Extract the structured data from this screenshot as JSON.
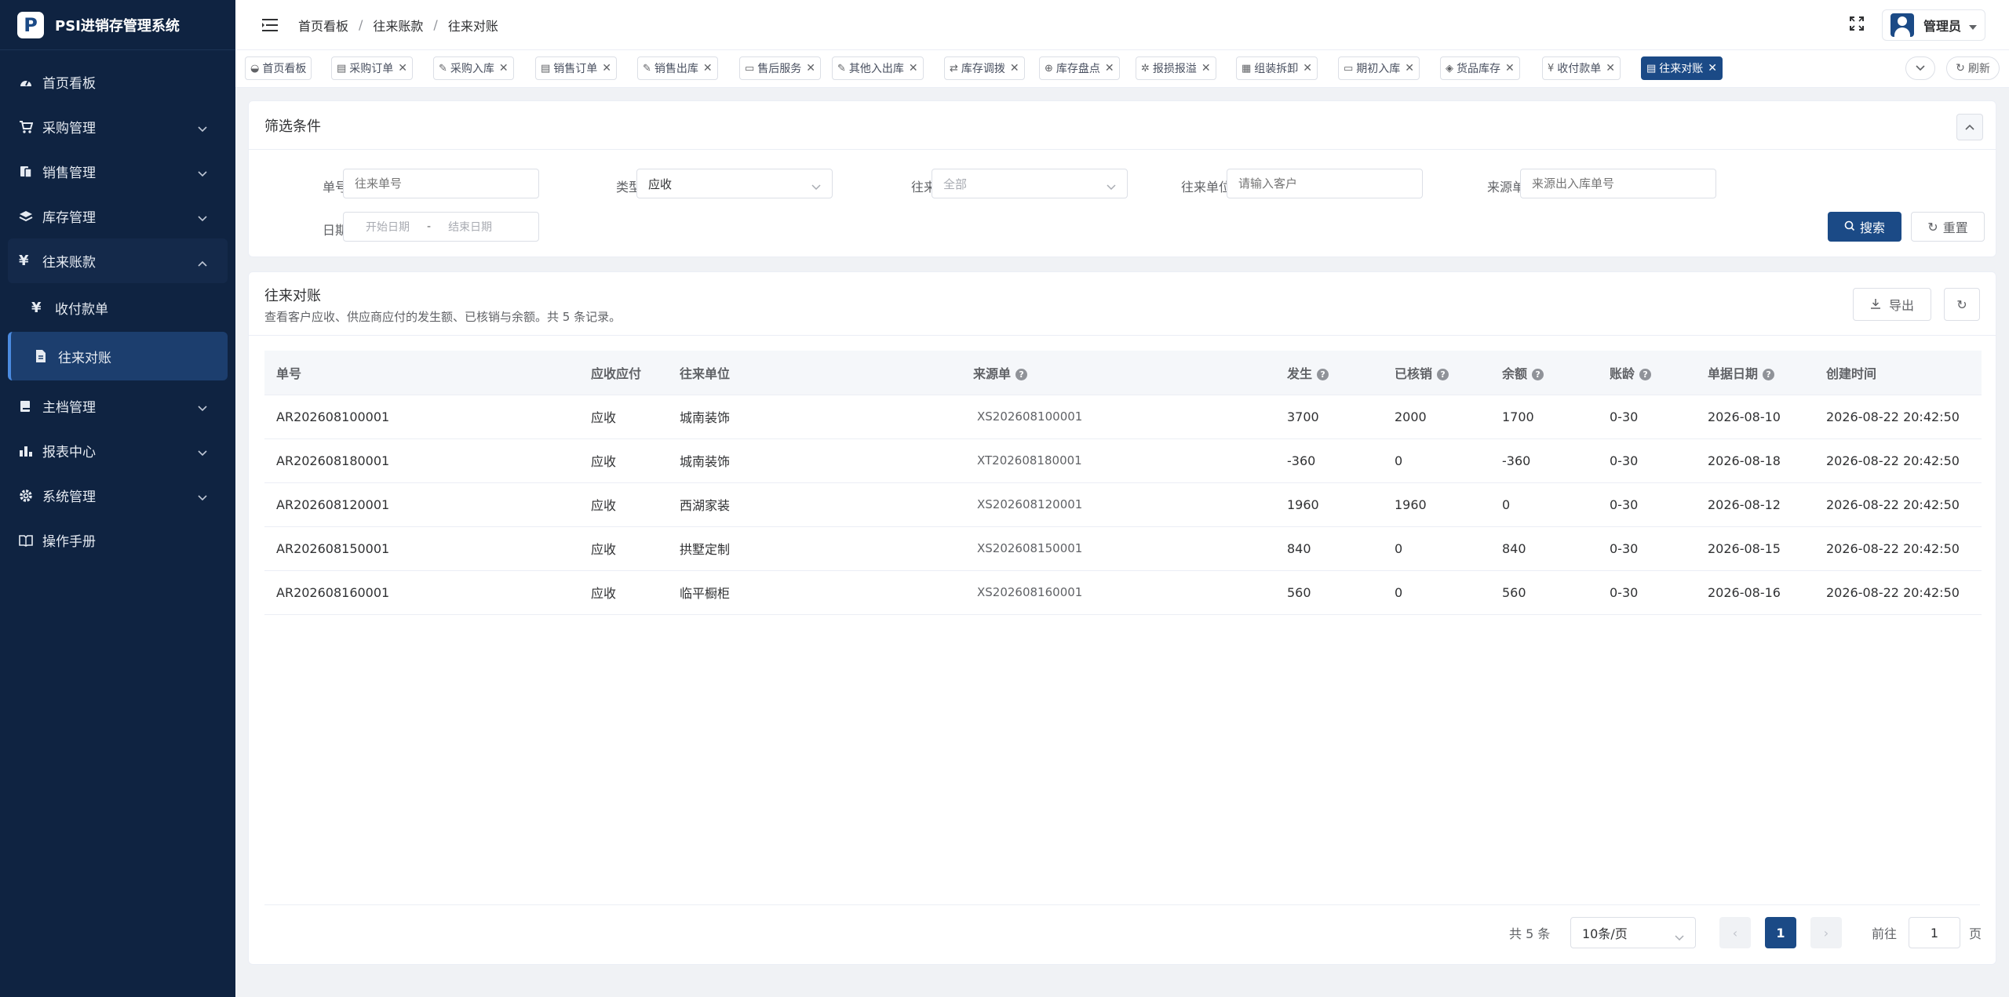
{
  "app": {
    "title": "PSI进销存管理系统",
    "logo_letter": "P"
  },
  "sidebar": {
    "items": [
      {
        "label": "首页看板",
        "icon": "dashboard-icon"
      },
      {
        "label": "采购管理",
        "icon": "cart-icon"
      },
      {
        "label": "销售管理",
        "icon": "sales-icon"
      },
      {
        "label": "库存管理",
        "icon": "layers-icon"
      },
      {
        "label": "往来账款",
        "icon": "yen-icon",
        "children": [
          {
            "label": "收付款单",
            "icon": "yen-icon"
          },
          {
            "label": "往来对账",
            "icon": "document-icon",
            "active": true
          }
        ]
      },
      {
        "label": "主档管理",
        "icon": "folder-icon"
      },
      {
        "label": "报表中心",
        "icon": "bar-chart-icon"
      },
      {
        "label": "系统管理",
        "icon": "gear-icon"
      },
      {
        "label": "操作手册",
        "icon": "book-icon"
      }
    ]
  },
  "header": {
    "breadcrumb": [
      "首页看板",
      "往来账款",
      "往来对账"
    ],
    "user": "管理员"
  },
  "tags": [
    {
      "label": "首页看板",
      "closable": false
    },
    {
      "label": "采购订单",
      "closable": true
    },
    {
      "label": "采购入库",
      "closable": true
    },
    {
      "label": "销售订单",
      "closable": true
    },
    {
      "label": "销售出库",
      "closable": true
    },
    {
      "label": "售后服务",
      "closable": true
    },
    {
      "label": "其他入出库",
      "closable": true
    },
    {
      "label": "库存调拨",
      "closable": true
    },
    {
      "label": "库存盘点",
      "closable": true
    },
    {
      "label": "报损报溢",
      "closable": true
    },
    {
      "label": "组装拆卸",
      "closable": true
    },
    {
      "label": "期初入库",
      "closable": true
    },
    {
      "label": "货品库存",
      "closable": true
    },
    {
      "label": "收付款单",
      "closable": true
    },
    {
      "label": "往来对账",
      "closable": true,
      "active": true
    }
  ],
  "tag_actions": {
    "refresh": "刷新"
  },
  "filter": {
    "title": "筛选条件",
    "doc_no": {
      "label": "单号",
      "placeholder": "往来单号"
    },
    "type": {
      "label": "类型",
      "value": "应收"
    },
    "party_type": {
      "label": "往来",
      "value": "全部"
    },
    "party": {
      "label": "往来单位",
      "placeholder": "请输入客户"
    },
    "source": {
      "label": "来源单",
      "placeholder": "来源出入库单号"
    },
    "date": {
      "label": "日期",
      "start": "开始日期",
      "sep": "-",
      "end": "结束日期"
    },
    "search": "搜索",
    "reset": "重置"
  },
  "table": {
    "title": "往来对账",
    "description": "查看客户应收、供应商应付的发生额、已核销与余额。共 5 条记录。",
    "export": "导出",
    "columns": [
      "单号",
      "应收应付",
      "往来单位",
      "来源单",
      "发生",
      "已核销",
      "余额",
      "账龄",
      "单据日期",
      "创建时间"
    ],
    "rows": [
      [
        "AR202608100001",
        "应收",
        "城南装饰",
        "XS202608100001",
        "3700",
        "2000",
        "1700",
        "0-30",
        "2026-08-10",
        "2026-08-22 20:42:50"
      ],
      [
        "AR202608180001",
        "应收",
        "城南装饰",
        "XT202608180001",
        "-360",
        "0",
        "-360",
        "0-30",
        "2026-08-18",
        "2026-08-22 20:42:50"
      ],
      [
        "AR202608120001",
        "应收",
        "西湖家装",
        "XS202608120001",
        "1960",
        "1960",
        "0",
        "0-30",
        "2026-08-12",
        "2026-08-22 20:42:50"
      ],
      [
        "AR202608150001",
        "应收",
        "拱墅定制",
        "XS202608150001",
        "840",
        "0",
        "840",
        "0-30",
        "2026-08-15",
        "2026-08-22 20:42:50"
      ],
      [
        "AR202608160001",
        "应收",
        "临平橱柜",
        "XS202608160001",
        "560",
        "0",
        "560",
        "0-30",
        "2026-08-16",
        "2026-08-22 20:42:50"
      ]
    ]
  },
  "pagination": {
    "total": "共 5 条",
    "page_size": "10条/页",
    "current": "1",
    "goto_label": "前往",
    "goto_value": "1",
    "page_suffix": "页"
  },
  "colors": {
    "sidebar": "#0f2341",
    "primary": "#1b4a86"
  }
}
